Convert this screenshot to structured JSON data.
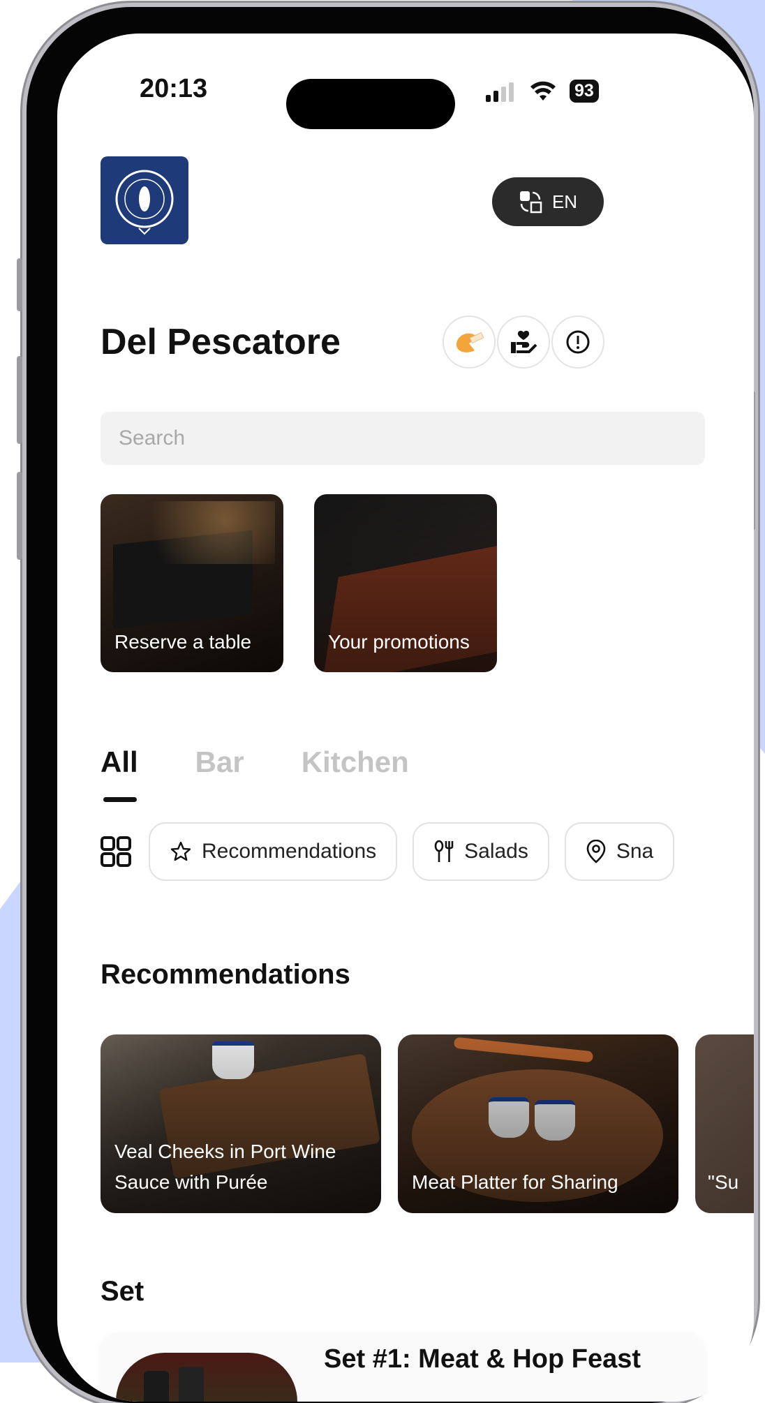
{
  "status_bar": {
    "time": "20:13",
    "battery": "93"
  },
  "header": {
    "language": "EN",
    "restaurant_name": "Del Pescatore"
  },
  "search": {
    "placeholder": "Search"
  },
  "quick_actions": [
    {
      "label": "Reserve a table"
    },
    {
      "label": "Your promotions"
    }
  ],
  "tabs": [
    {
      "label": "All",
      "active": true
    },
    {
      "label": "Bar",
      "active": false
    },
    {
      "label": "Kitchen",
      "active": false
    }
  ],
  "categories": [
    {
      "label": "Recommendations",
      "icon": "star-icon"
    },
    {
      "label": "Salads",
      "icon": "cutlery-icon"
    },
    {
      "label": "Sna",
      "icon": "location-icon"
    }
  ],
  "sections": {
    "recommendations": {
      "title": "Recommendations",
      "items": [
        {
          "label": "Veal Cheeks in Port Wine Sauce with Purée"
        },
        {
          "label": "Meat Platter for Sharing"
        },
        {
          "label": "\"Su"
        }
      ]
    },
    "set": {
      "title": "Set",
      "items": [
        {
          "label": "Set #1: Meat & Hop Feast"
        }
      ]
    }
  },
  "colors": {
    "accent_blue": "#c9d6ff",
    "logo_navy": "#1e3a78",
    "dark_pill": "#2b2b2b"
  }
}
